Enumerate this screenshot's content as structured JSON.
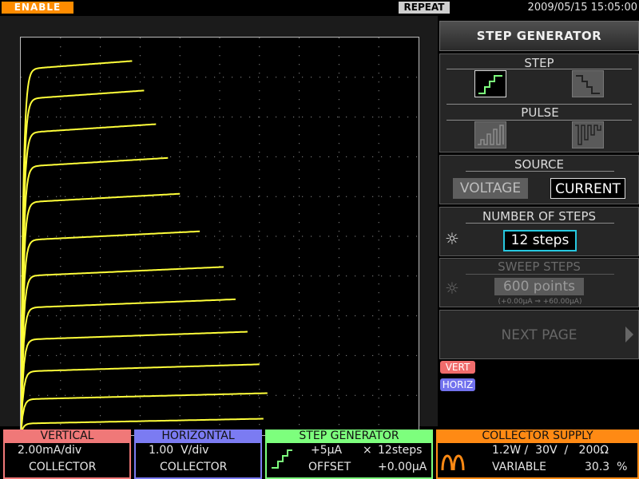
{
  "topbar": {
    "enable": "ENABLE",
    "repeat": "REPEAT",
    "datetime": "2009/05/15 15:05:00"
  },
  "colors": {
    "trace": "#ffff3a",
    "vertical": "#f07878",
    "horizontal": "#7b7bf2",
    "step_generator": "#7dff7d",
    "collector_supply": "#ff8a14"
  },
  "menu": {
    "title": "STEP GENERATOR",
    "step": {
      "label": "STEP",
      "up_icon": "staircase-up-icon",
      "down_icon": "staircase-down-icon",
      "selected": "up"
    },
    "pulse": {
      "label": "PULSE",
      "up_icon": "pulse-up-icon",
      "down_icon": "pulse-down-icon"
    },
    "source": {
      "label": "SOURCE",
      "voltage": "VOLTAGE",
      "current": "CURRENT",
      "selected": "CURRENT"
    },
    "number_of_steps": {
      "label": "NUMBER OF STEPS",
      "value": "12 steps"
    },
    "sweep_steps": {
      "label": "SWEEP STEPS",
      "value": "600 points",
      "range": "(+0.00μA ⇒ +60.00μA)"
    },
    "next_page": "NEXT PAGE"
  },
  "chips": {
    "vert": "VERT",
    "horiz": "HORIZ"
  },
  "status": {
    "vertical": {
      "title": "VERTICAL",
      "scale": "2.00mA/div",
      "source": "COLLECTOR"
    },
    "horizontal": {
      "title": "HORIZONTAL",
      "scale": "1.00  V/div",
      "source": "COLLECTOR"
    },
    "step_generator": {
      "title": "STEP GENERATOR",
      "step": "+5μA",
      "times": "×",
      "steps": "12steps",
      "offset_label": "OFFSET",
      "offset": "+0.00μA"
    },
    "collector_supply": {
      "title": "COLLECTOR SUPPLY",
      "rating": "1.2W /  30V  /   200Ω",
      "mode": "VARIABLE",
      "percent": "30.3  %"
    }
  },
  "chart_data": {
    "type": "line",
    "xlabel": "",
    "ylabel": "",
    "xlim": [
      0,
      10
    ],
    "ylim": [
      0,
      20
    ],
    "grid": true,
    "series": [
      {
        "x_end": 6.1,
        "i_sat": 0.58,
        "slope": 0.04
      },
      {
        "x_end": 6.2,
        "i_sat": 1.8,
        "slope": 0.05
      },
      {
        "x_end": 6.0,
        "i_sat": 3.2,
        "slope": 0.06
      },
      {
        "x_end": 5.7,
        "i_sat": 4.8,
        "slope": 0.07
      },
      {
        "x_end": 5.4,
        "i_sat": 6.4,
        "slope": 0.08
      },
      {
        "x_end": 5.1,
        "i_sat": 8.0,
        "slope": 0.09
      },
      {
        "x_end": 4.5,
        "i_sat": 9.8,
        "slope": 0.1
      },
      {
        "x_end": 4.0,
        "i_sat": 11.7,
        "slope": 0.11
      },
      {
        "x_end": 3.7,
        "i_sat": 13.5,
        "slope": 0.12
      },
      {
        "x_end": 3.4,
        "i_sat": 15.2,
        "slope": 0.13
      },
      {
        "x_end": 3.1,
        "i_sat": 16.9,
        "slope": 0.14
      },
      {
        "x_end": 2.8,
        "i_sat": 18.4,
        "slope": 0.15
      }
    ]
  }
}
